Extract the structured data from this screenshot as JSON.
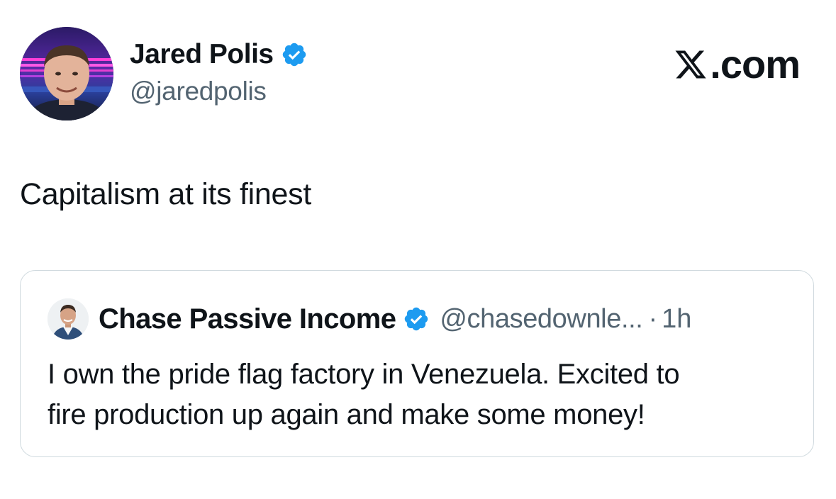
{
  "brand": {
    "label": ".com",
    "icon": "x-logo-icon"
  },
  "tweet": {
    "author": {
      "name": "Jared Polis",
      "handle": "@jaredpolis",
      "verified": true,
      "avatar": "avatar-jared-polis"
    },
    "text": "Capitalism at its finest"
  },
  "quoted_tweet": {
    "author": {
      "name": "Chase Passive Income",
      "handle": "@chasedownle...",
      "verified": true,
      "avatar": "avatar-chase"
    },
    "separator": "·",
    "time": "1h",
    "text_lines": [
      "I own the pride flag factory in Venezuela. Excited to",
      "fire production up again and make some money!"
    ]
  },
  "colors": {
    "verified_blue": "#1d9bf0",
    "text_primary": "#0f1419",
    "text_secondary": "#536471",
    "border": "#cfd9de"
  }
}
